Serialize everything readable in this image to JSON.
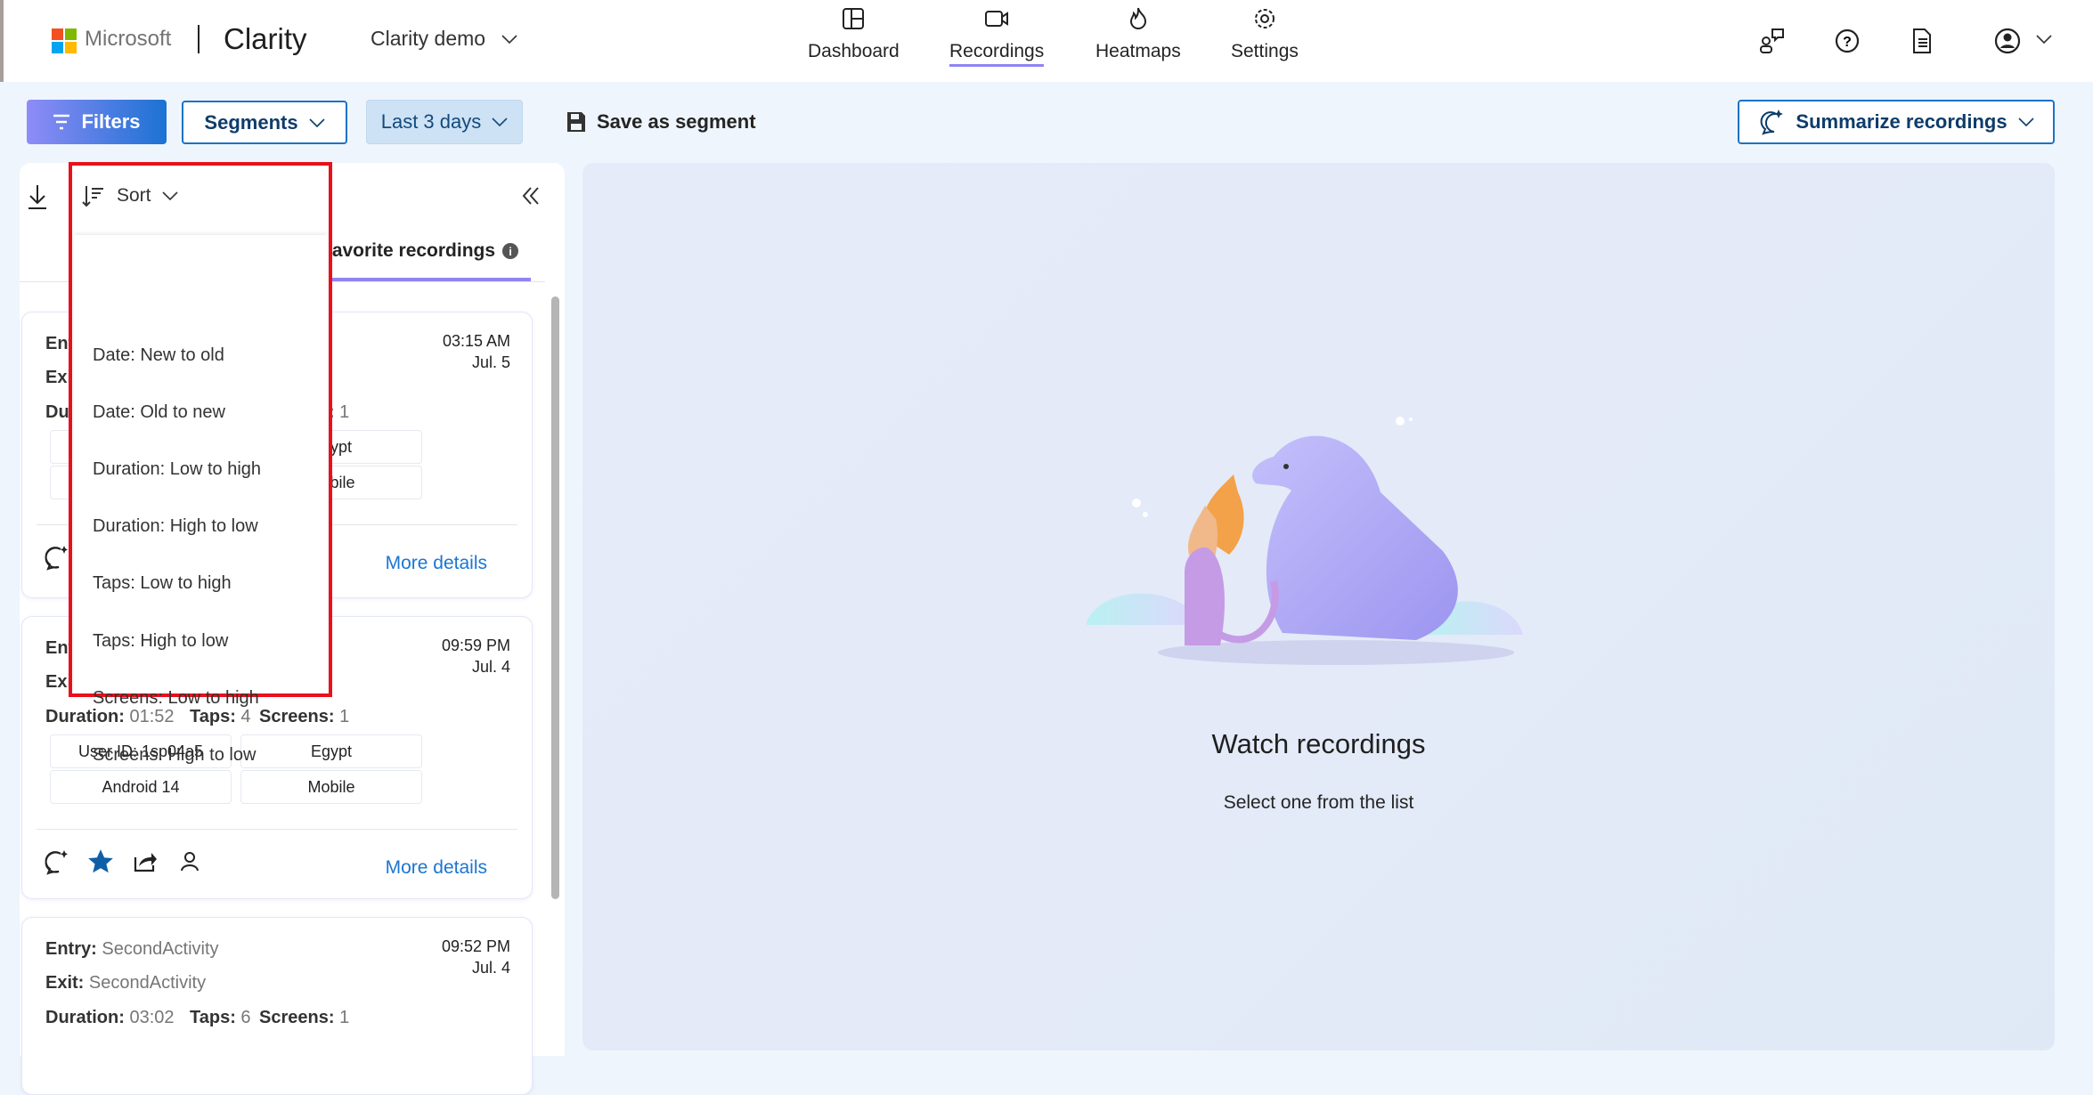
{
  "header": {
    "brand": "Microsoft",
    "product": "Clarity",
    "project": "Clarity demo",
    "nav": [
      {
        "label": "Dashboard",
        "icon": "dashboard-icon"
      },
      {
        "label": "Recordings",
        "icon": "video-camera-icon",
        "active": true
      },
      {
        "label": "Heatmaps",
        "icon": "flame-icon"
      },
      {
        "label": "Settings",
        "icon": "gear-icon"
      }
    ],
    "icons": [
      "people-chat-icon",
      "help-icon",
      "document-list-icon",
      "account-icon"
    ]
  },
  "toolbar": {
    "filters": "Filters",
    "segments": "Segments",
    "date_range": "Last 3 days",
    "save_segment": "Save as segment",
    "summarize": "Summarize recordings"
  },
  "left_panel": {
    "tab_favorites": "Favorite recordings",
    "sort_label": "Sort"
  },
  "sort_menu": {
    "items": [
      "Date: New to old",
      "Date: Old to new",
      "Duration: Low to high",
      "Duration: High to low",
      "Taps: Low to high",
      "Taps: High to low",
      "Screens: Low to high",
      "Screens: High to low"
    ]
  },
  "labels": {
    "entry": "Entry:",
    "exit": "Exit:",
    "duration": "Duration:",
    "taps": "Taps:",
    "screens": "Screens:",
    "more": "More details"
  },
  "recordings": [
    {
      "time": "03:15 AM",
      "date": "Jul. 5",
      "screens": "1",
      "chips": [
        "",
        "Egypt",
        "",
        "Mobile"
      ]
    },
    {
      "time": "09:59 PM",
      "date": "Jul. 4",
      "duration": "01:52",
      "taps": "4",
      "screens": "1",
      "chips": [
        "User ID: 1sp04a5",
        "Egypt",
        "Android 14",
        "Mobile"
      ],
      "favorite": true
    },
    {
      "time": "09:52 PM",
      "date": "Jul. 4",
      "entry": "SecondActivity",
      "exit": "SecondActivity",
      "duration": "03:02",
      "taps": "6",
      "screens": "1"
    }
  ],
  "main": {
    "title": "Watch recordings",
    "subtitle": "Select one from the list"
  },
  "colors": {
    "accent": "#1b76d2",
    "tab_underline": "#8f85f2",
    "highlight_border": "#e8111c"
  }
}
